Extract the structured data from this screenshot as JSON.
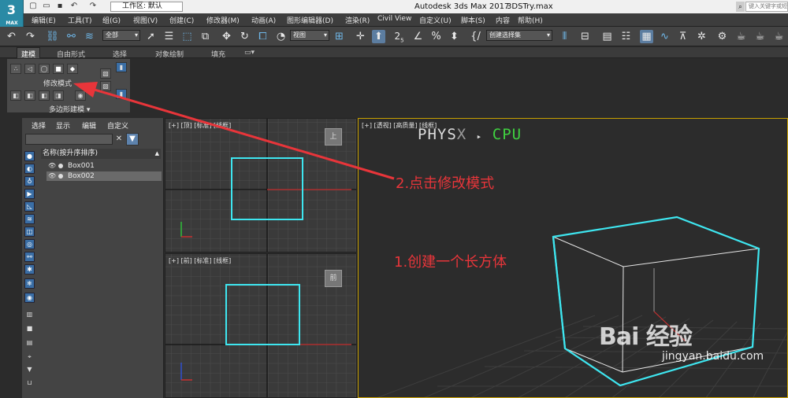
{
  "title_bar": {
    "logo_text": "3",
    "logo_sub": "MAX",
    "workspace": "工作区: 默认",
    "app_name": "Autodesk 3ds Max 2017",
    "file_name": "3DSTry.max",
    "search_placeholder": "键入关键字或短语"
  },
  "menu": [
    "编辑(E)",
    "工具(T)",
    "组(G)",
    "视图(V)",
    "创建(C)",
    "修改器(M)",
    "动画(A)",
    "图形编辑器(D)",
    "渲染(R)",
    "Civil View",
    "自定义(U)",
    "脚本(S)",
    "内容",
    "帮助(H)"
  ],
  "toolbar": {
    "selection_filter": "全部",
    "ref_coord": "视图",
    "named_selection": "创建选择集",
    "snap_label": "2",
    "snap_sub": "5"
  },
  "ribbon_tabs": [
    "建模",
    "自由形式",
    "选择",
    "对象绘制",
    "填充"
  ],
  "ribbon": {
    "modify_mode": "修改模式",
    "poly_modeling": "多边形建模"
  },
  "scene_explorer": {
    "menus": [
      "选择",
      "显示",
      "编辑",
      "自定义"
    ],
    "column_header": "名称(按升序排序)",
    "items": [
      {
        "name": "Box001",
        "selected": false
      },
      {
        "name": "Box002",
        "selected": true
      }
    ]
  },
  "viewports": {
    "top_label": "[+] [顶] [标准] [线框]",
    "front_label": "[+] [前] [标准] [线框]",
    "persp_label": "[+] [透视] [高质量] [线框]",
    "top_cube": "上",
    "front_cube": "前"
  },
  "physx": {
    "a": "PHYS",
    "x": "X",
    "sep": "▸",
    "cpu": "CPU"
  },
  "annotations": {
    "step1": "1.创建一个长方体",
    "step2": "2.点击修改模式"
  },
  "watermark": {
    "main": "Bai 经验",
    "sub": "jingyan.baidu.com"
  },
  "colors": {
    "annotation": "#e8353a",
    "selection_box": "#3ee6f0",
    "physx_cpu": "#3fd140",
    "axis_red": "#c83030"
  }
}
